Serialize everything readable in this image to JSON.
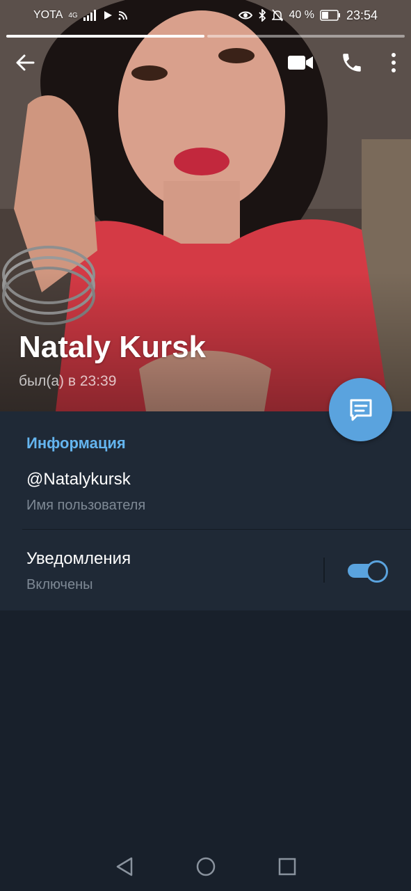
{
  "status_bar": {
    "carrier": "YOTA",
    "network": "4G",
    "battery": "40 %",
    "time": "23:54",
    "icons": [
      "signal-icon",
      "play-icon",
      "cast-icon",
      "eye-icon",
      "bluetooth-icon",
      "mute-icon",
      "battery-icon"
    ]
  },
  "story": {
    "segments": 2,
    "active_index": 0
  },
  "toolbar": {
    "icons": [
      "back-arrow-icon",
      "video-call-icon",
      "phone-icon",
      "more-vertical-icon"
    ]
  },
  "profile": {
    "name": "Nataly Kursk",
    "last_seen": "был(а) в 23:39"
  },
  "info": {
    "header": "Информация",
    "username": "@Natalykursk",
    "username_label": "Имя пользователя",
    "notifications_title": "Уведомления",
    "notifications_state": "Включены",
    "notifications_enabled": true
  },
  "colors": {
    "accent": "#5aa3de",
    "header_text": "#64b5ef",
    "panel": "#1f2936",
    "background": "#18202b"
  },
  "nav": {
    "icons": [
      "back-triangle-icon",
      "home-circle-icon",
      "recents-square-icon"
    ]
  }
}
